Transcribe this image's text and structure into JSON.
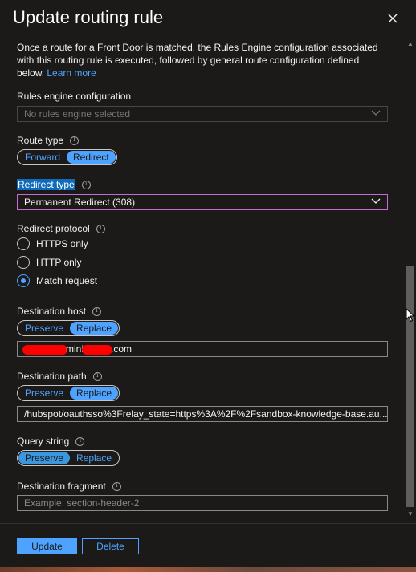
{
  "header": {
    "title": "Update routing rule"
  },
  "intro": {
    "text": "Once a route for a Front Door is matched, the Rules Engine configuration associated with this routing rule is executed, followed by general route configuration defined below.",
    "link": "Learn more"
  },
  "rules_engine": {
    "label": "Rules engine configuration",
    "placeholder": "No rules engine selected"
  },
  "route_type": {
    "label": "Route type",
    "options": [
      "Forward",
      "Redirect"
    ],
    "selected": "Redirect"
  },
  "redirect_type": {
    "label": "Redirect type",
    "value": "Permanent Redirect (308)"
  },
  "redirect_protocol": {
    "label": "Redirect protocol",
    "options": [
      "HTTPS only",
      "HTTP only",
      "Match request"
    ],
    "selected": "Match request"
  },
  "destination_host": {
    "label": "Destination host",
    "options": [
      "Preserve",
      "Replace"
    ],
    "selected": "Replace",
    "value_mid": "mini",
    "value_suffix": ".com"
  },
  "destination_path": {
    "label": "Destination path",
    "options": [
      "Preserve",
      "Replace"
    ],
    "selected": "Replace",
    "value": "/hubspot/oauthsso%3Frelay_state=https%3A%2F%2Fsandbox-knowledge-base.au..."
  },
  "query_string": {
    "label": "Query string",
    "options": [
      "Preserve",
      "Replace"
    ],
    "selected": "Preserve"
  },
  "destination_fragment": {
    "label": "Destination fragment",
    "placeholder": "Example: section-header-2"
  },
  "footer": {
    "update_label": "Update",
    "delete_label": "Delete"
  },
  "colors": {
    "background": "#1b1a19",
    "accent": "#4da3ff",
    "focus_border": "#c46bd6",
    "redaction": "#ff0000"
  },
  "icons": [
    "close-icon",
    "info-icon",
    "chevron-down-icon",
    "mouse-pointer-icon"
  ]
}
